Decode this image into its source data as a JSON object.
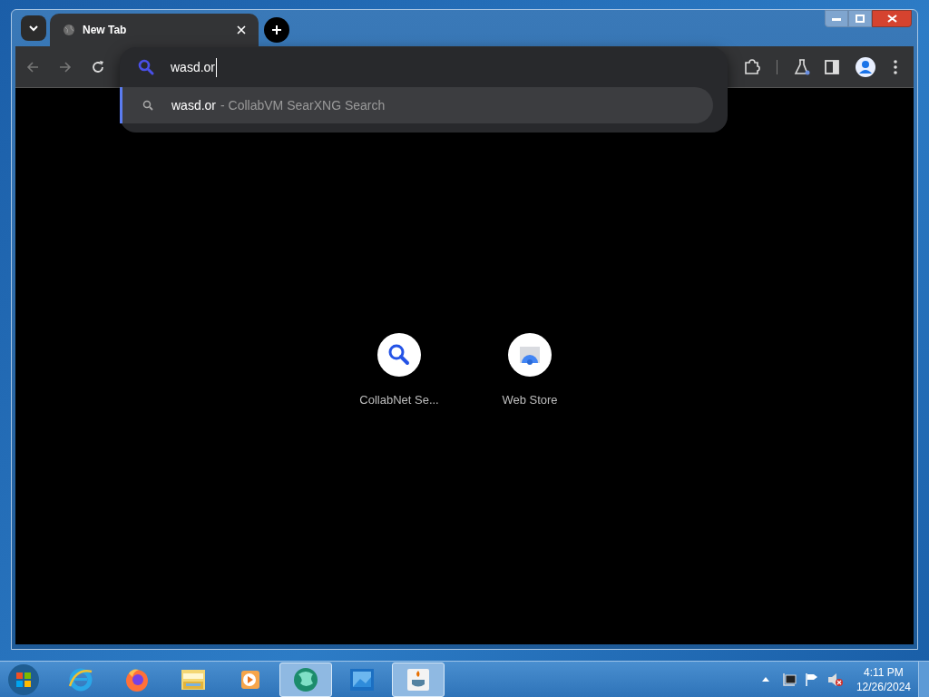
{
  "tabs": [
    {
      "title": "New Tab",
      "selected": true
    }
  ],
  "omnibox": {
    "value": "wasd.or"
  },
  "suggestions": [
    {
      "query": "wasd.or",
      "detail": "- CollabVM SearXNG Search",
      "selected": true
    }
  ],
  "shortcuts": [
    {
      "label": "CollabNet Se...",
      "kind": "search"
    },
    {
      "label": "Web Store",
      "kind": "store"
    }
  ],
  "taskbar": {
    "items": [
      {
        "kind": "ie",
        "active": false
      },
      {
        "kind": "firefox",
        "active": false
      },
      {
        "kind": "explorer",
        "active": false
      },
      {
        "kind": "media",
        "active": false
      },
      {
        "kind": "globe",
        "active": true
      },
      {
        "kind": "remote",
        "active": false
      },
      {
        "kind": "java",
        "active": true
      }
    ]
  },
  "clock": {
    "time": "4:11 PM",
    "date": "12/26/2024"
  }
}
